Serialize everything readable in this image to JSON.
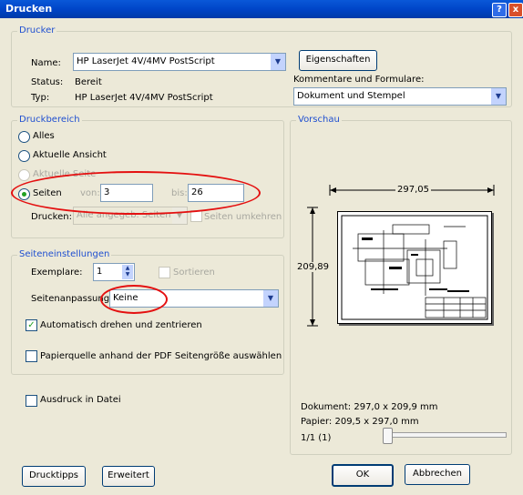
{
  "window": {
    "title": "Drucken"
  },
  "printer": {
    "legend": "Drucker",
    "name_label": "Name:",
    "name_value": "HP LaserJet 4V/4MV PostScript",
    "status_label": "Status:",
    "status_value": "Bereit",
    "type_label": "Typ:",
    "type_value": "HP LaserJet 4V/4MV PostScript",
    "properties_button": "Eigenschaften",
    "comments_label": "Kommentare und Formulare:",
    "comments_value": "Dokument und Stempel"
  },
  "range": {
    "legend": "Druckbereich",
    "all": "Alles",
    "current_view": "Aktuelle Ansicht",
    "current_page": "Aktuelle Seite",
    "pages": "Seiten",
    "from_label": "von:",
    "from_value": "3",
    "to_label": "bis:",
    "to_value": "26",
    "print_label": "Drucken:",
    "print_value": "Alle angegeb. Seiten",
    "reverse_label": "Seiten umkehren"
  },
  "page_setup": {
    "legend": "Seiteneinstellungen",
    "copies_label": "Exemplare:",
    "copies_value": "1",
    "collate_label": "Sortieren",
    "scaling_label": "Seitenanpassung:",
    "scaling_value": "Keine",
    "autorotate_label": "Automatisch drehen und zentrieren",
    "autorotate_checked": true,
    "paper_source_label": "Papierquelle anhand der PDF Seitengröße auswählen"
  },
  "print_to_file": "Ausdruck in Datei",
  "preview": {
    "legend": "Vorschau",
    "width_label": "297,05",
    "height_label": "209,89",
    "document": "Dokument: 297,0 x 209,9 mm",
    "paper": "Papier: 209,5 x 297,0 mm",
    "page_counter": "1/1 (1)"
  },
  "buttons": {
    "tips": "Drucktipps",
    "advanced": "Erweitert",
    "ok": "OK",
    "cancel": "Abbrechen"
  },
  "title_buttons": {
    "help": "?",
    "close": "x"
  },
  "colors": {
    "titlebar": "#0045c8",
    "annotation": "#e41010",
    "legend": "#1f4fd0"
  }
}
